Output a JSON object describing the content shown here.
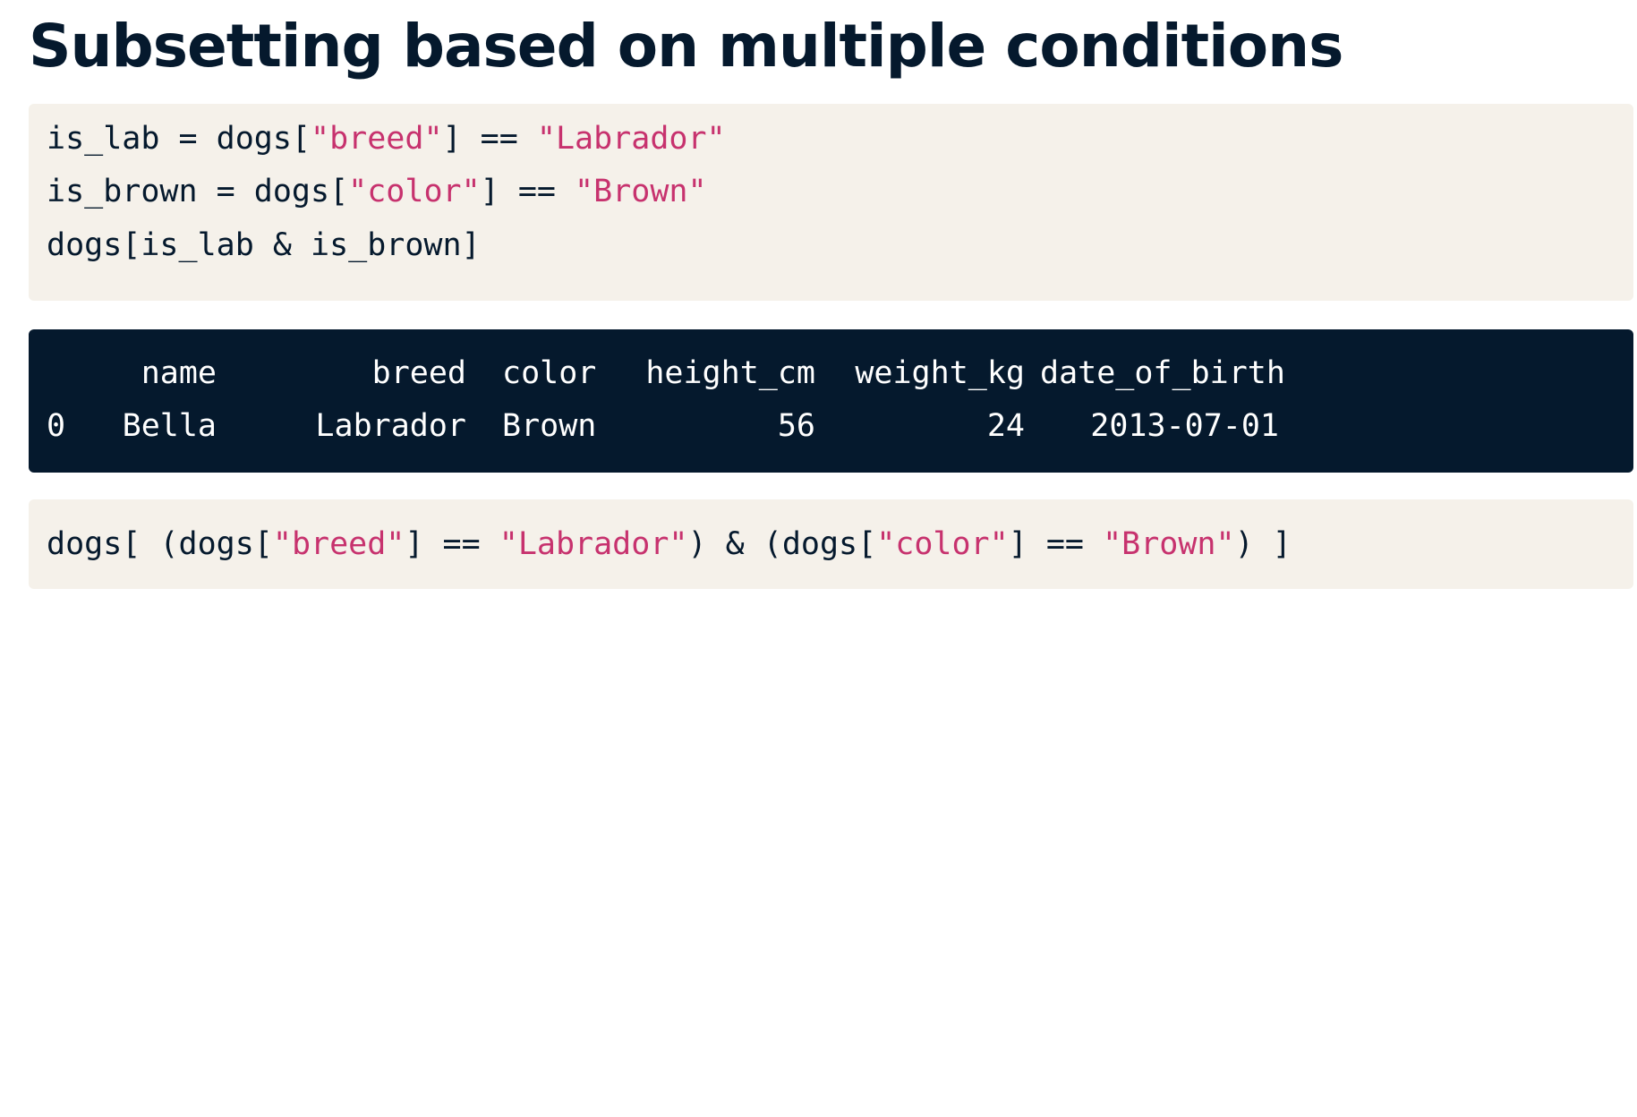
{
  "title": "Subsetting based on multiple conditions",
  "code1": {
    "lines": [
      {
        "a": "is_lab = dogs[",
        "s1": "\"breed\"",
        "b": "] == ",
        "s2": "\"Labrador\""
      },
      {
        "a": "is_brown = dogs[",
        "s1": "\"color\"",
        "b": "] == ",
        "s2": "\"Brown\""
      },
      {
        "a": "dogs[is_lab & is_brown]"
      }
    ]
  },
  "output": {
    "headers": [
      "name",
      "breed",
      "color",
      "height_cm",
      "weight_kg",
      "date_of_birth"
    ],
    "rows": [
      {
        "index": "0",
        "cells": [
          "Bella",
          "Labrador",
          "Brown",
          "56",
          "24",
          "2013-07-01"
        ]
      }
    ]
  },
  "code2": {
    "t1": "dogs[ (dogs[",
    "s1": "\"breed\"",
    "t2": "] == ",
    "s2": "\"Labrador\"",
    "t3": ") & (dogs[",
    "s3": "\"color\"",
    "t4": "] == ",
    "s4": "\"Brown\"",
    "t5": ") ]"
  }
}
